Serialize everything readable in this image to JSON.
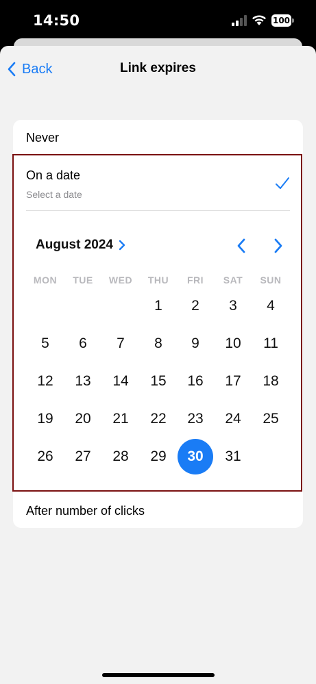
{
  "status": {
    "time": "14:50",
    "battery": "100"
  },
  "nav": {
    "back_label": "Back",
    "title": "Link expires"
  },
  "options": {
    "never": "Never",
    "on_date": "On a date",
    "on_date_subtitle": "Select a date",
    "after_clicks": "After number of clicks"
  },
  "calendar": {
    "month_label": "August 2024",
    "weekdays": [
      "MON",
      "TUE",
      "WED",
      "THU",
      "FRI",
      "SAT",
      "SUN"
    ],
    "first_weekday_index": 3,
    "days_in_month": 31,
    "selected_day": "30"
  },
  "colors": {
    "accent": "#1a7cf5",
    "highlight_border": "#7a1010"
  }
}
